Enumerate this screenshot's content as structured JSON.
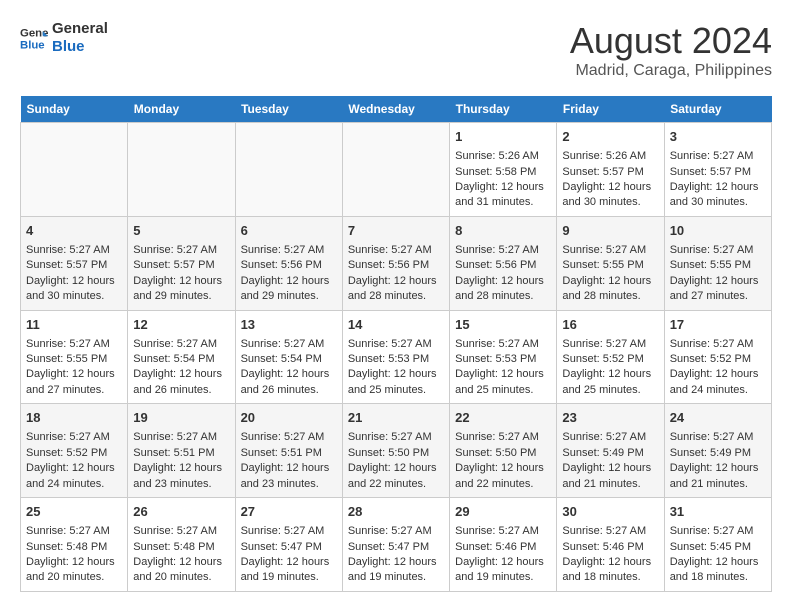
{
  "header": {
    "logo_line1": "General",
    "logo_line2": "Blue",
    "month_year": "August 2024",
    "location": "Madrid, Caraga, Philippines"
  },
  "weekdays": [
    "Sunday",
    "Monday",
    "Tuesday",
    "Wednesday",
    "Thursday",
    "Friday",
    "Saturday"
  ],
  "weeks": [
    {
      "stripe": "a",
      "days": [
        {
          "num": "",
          "content": ""
        },
        {
          "num": "",
          "content": ""
        },
        {
          "num": "",
          "content": ""
        },
        {
          "num": "",
          "content": ""
        },
        {
          "num": "1",
          "content": "Sunrise: 5:26 AM\nSunset: 5:58 PM\nDaylight: 12 hours\nand 31 minutes."
        },
        {
          "num": "2",
          "content": "Sunrise: 5:26 AM\nSunset: 5:57 PM\nDaylight: 12 hours\nand 30 minutes."
        },
        {
          "num": "3",
          "content": "Sunrise: 5:27 AM\nSunset: 5:57 PM\nDaylight: 12 hours\nand 30 minutes."
        }
      ]
    },
    {
      "stripe": "b",
      "days": [
        {
          "num": "4",
          "content": "Sunrise: 5:27 AM\nSunset: 5:57 PM\nDaylight: 12 hours\nand 30 minutes."
        },
        {
          "num": "5",
          "content": "Sunrise: 5:27 AM\nSunset: 5:57 PM\nDaylight: 12 hours\nand 29 minutes."
        },
        {
          "num": "6",
          "content": "Sunrise: 5:27 AM\nSunset: 5:56 PM\nDaylight: 12 hours\nand 29 minutes."
        },
        {
          "num": "7",
          "content": "Sunrise: 5:27 AM\nSunset: 5:56 PM\nDaylight: 12 hours\nand 28 minutes."
        },
        {
          "num": "8",
          "content": "Sunrise: 5:27 AM\nSunset: 5:56 PM\nDaylight: 12 hours\nand 28 minutes."
        },
        {
          "num": "9",
          "content": "Sunrise: 5:27 AM\nSunset: 5:55 PM\nDaylight: 12 hours\nand 28 minutes."
        },
        {
          "num": "10",
          "content": "Sunrise: 5:27 AM\nSunset: 5:55 PM\nDaylight: 12 hours\nand 27 minutes."
        }
      ]
    },
    {
      "stripe": "a",
      "days": [
        {
          "num": "11",
          "content": "Sunrise: 5:27 AM\nSunset: 5:55 PM\nDaylight: 12 hours\nand 27 minutes."
        },
        {
          "num": "12",
          "content": "Sunrise: 5:27 AM\nSunset: 5:54 PM\nDaylight: 12 hours\nand 26 minutes."
        },
        {
          "num": "13",
          "content": "Sunrise: 5:27 AM\nSunset: 5:54 PM\nDaylight: 12 hours\nand 26 minutes."
        },
        {
          "num": "14",
          "content": "Sunrise: 5:27 AM\nSunset: 5:53 PM\nDaylight: 12 hours\nand 25 minutes."
        },
        {
          "num": "15",
          "content": "Sunrise: 5:27 AM\nSunset: 5:53 PM\nDaylight: 12 hours\nand 25 minutes."
        },
        {
          "num": "16",
          "content": "Sunrise: 5:27 AM\nSunset: 5:52 PM\nDaylight: 12 hours\nand 25 minutes."
        },
        {
          "num": "17",
          "content": "Sunrise: 5:27 AM\nSunset: 5:52 PM\nDaylight: 12 hours\nand 24 minutes."
        }
      ]
    },
    {
      "stripe": "b",
      "days": [
        {
          "num": "18",
          "content": "Sunrise: 5:27 AM\nSunset: 5:52 PM\nDaylight: 12 hours\nand 24 minutes."
        },
        {
          "num": "19",
          "content": "Sunrise: 5:27 AM\nSunset: 5:51 PM\nDaylight: 12 hours\nand 23 minutes."
        },
        {
          "num": "20",
          "content": "Sunrise: 5:27 AM\nSunset: 5:51 PM\nDaylight: 12 hours\nand 23 minutes."
        },
        {
          "num": "21",
          "content": "Sunrise: 5:27 AM\nSunset: 5:50 PM\nDaylight: 12 hours\nand 22 minutes."
        },
        {
          "num": "22",
          "content": "Sunrise: 5:27 AM\nSunset: 5:50 PM\nDaylight: 12 hours\nand 22 minutes."
        },
        {
          "num": "23",
          "content": "Sunrise: 5:27 AM\nSunset: 5:49 PM\nDaylight: 12 hours\nand 21 minutes."
        },
        {
          "num": "24",
          "content": "Sunrise: 5:27 AM\nSunset: 5:49 PM\nDaylight: 12 hours\nand 21 minutes."
        }
      ]
    },
    {
      "stripe": "a",
      "days": [
        {
          "num": "25",
          "content": "Sunrise: 5:27 AM\nSunset: 5:48 PM\nDaylight: 12 hours\nand 20 minutes."
        },
        {
          "num": "26",
          "content": "Sunrise: 5:27 AM\nSunset: 5:48 PM\nDaylight: 12 hours\nand 20 minutes."
        },
        {
          "num": "27",
          "content": "Sunrise: 5:27 AM\nSunset: 5:47 PM\nDaylight: 12 hours\nand 19 minutes."
        },
        {
          "num": "28",
          "content": "Sunrise: 5:27 AM\nSunset: 5:47 PM\nDaylight: 12 hours\nand 19 minutes."
        },
        {
          "num": "29",
          "content": "Sunrise: 5:27 AM\nSunset: 5:46 PM\nDaylight: 12 hours\nand 19 minutes."
        },
        {
          "num": "30",
          "content": "Sunrise: 5:27 AM\nSunset: 5:46 PM\nDaylight: 12 hours\nand 18 minutes."
        },
        {
          "num": "31",
          "content": "Sunrise: 5:27 AM\nSunset: 5:45 PM\nDaylight: 12 hours\nand 18 minutes."
        }
      ]
    }
  ]
}
